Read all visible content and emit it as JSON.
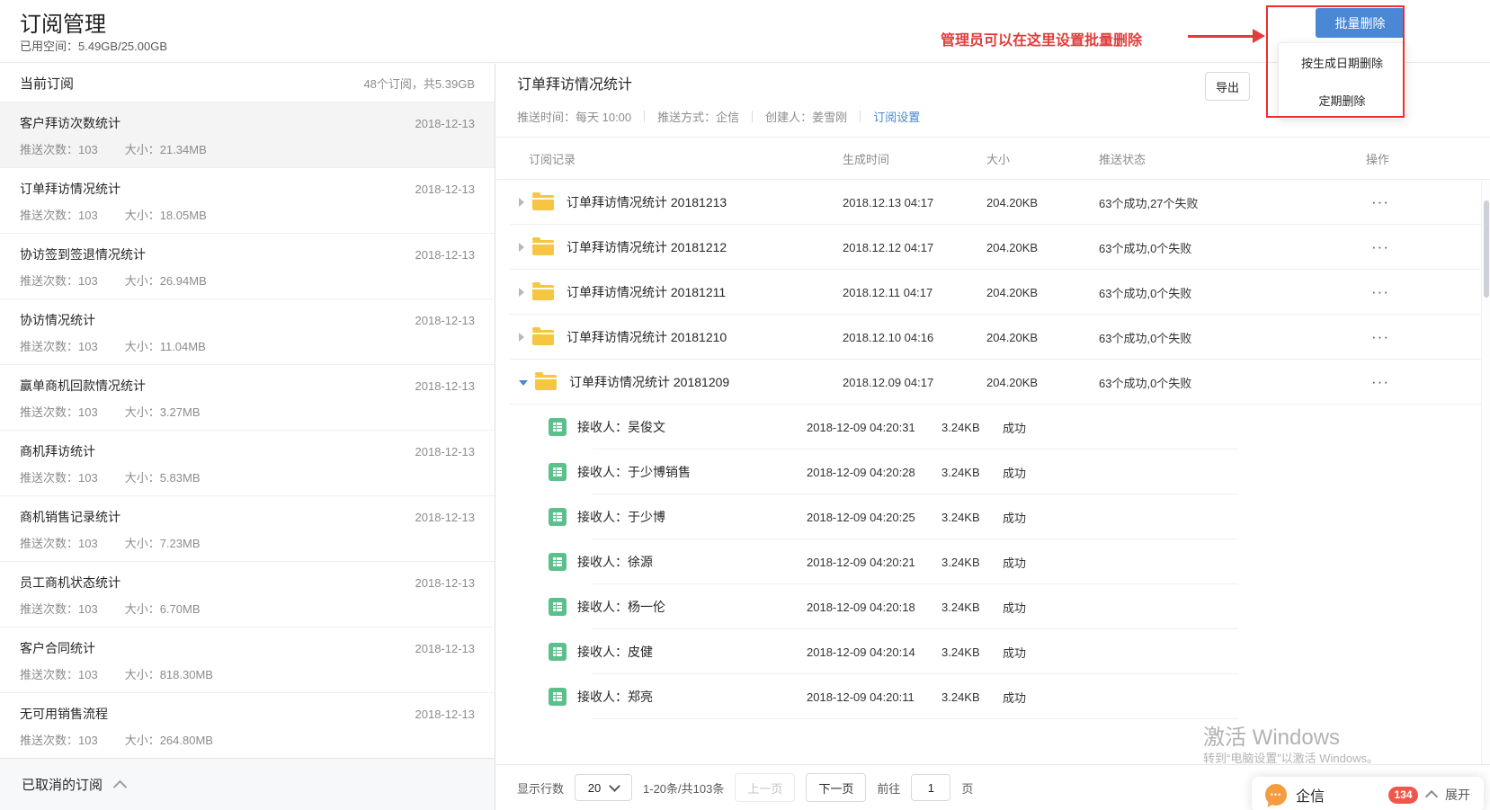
{
  "page": {
    "title": "订阅管理",
    "space_used": "已用空间：5.49GB/25.00GB"
  },
  "annotation": {
    "text": "管理员可以在这里设置批量删除",
    "color": "#e23b3b"
  },
  "batch_delete": {
    "button_label": "批量删除",
    "button_color": "#4a87d5",
    "menu_items": [
      {
        "label": "按生成日期删除"
      },
      {
        "label": "定期删除"
      }
    ]
  },
  "left_panel": {
    "header": "当前订阅",
    "summary": "48个订阅，共5.39GB",
    "items": [
      {
        "title": "客户拜访次数统计",
        "pushes": "推送次数：103",
        "size": "大小：21.34MB",
        "date": "2018-12-13",
        "selected": true
      },
      {
        "title": "订单拜访情况统计",
        "pushes": "推送次数：103",
        "size": "大小：18.05MB",
        "date": "2018-12-13",
        "selected": false
      },
      {
        "title": "协访签到签退情况统计",
        "pushes": "推送次数：103",
        "size": "大小：26.94MB",
        "date": "2018-12-13",
        "selected": false
      },
      {
        "title": "协访情况统计",
        "pushes": "推送次数：103",
        "size": "大小：11.04MB",
        "date": "2018-12-13",
        "selected": false
      },
      {
        "title": "赢单商机回款情况统计",
        "pushes": "推送次数：103",
        "size": "大小：3.27MB",
        "date": "2018-12-13",
        "selected": false
      },
      {
        "title": "商机拜访统计",
        "pushes": "推送次数：103",
        "size": "大小：5.83MB",
        "date": "2018-12-13",
        "selected": false
      },
      {
        "title": "商机销售记录统计",
        "pushes": "推送次数：103",
        "size": "大小：7.23MB",
        "date": "2018-12-13",
        "selected": false
      },
      {
        "title": "员工商机状态统计",
        "pushes": "推送次数：103",
        "size": "大小：6.70MB",
        "date": "2018-12-13",
        "selected": false
      },
      {
        "title": "客户合同统计",
        "pushes": "推送次数：103",
        "size": "大小：818.30MB",
        "date": "2018-12-13",
        "selected": false
      },
      {
        "title": "无可用销售流程",
        "pushes": "推送次数：103",
        "size": "大小：264.80MB",
        "date": "2018-12-13",
        "selected": false
      }
    ],
    "footer_label": "已取消的订阅"
  },
  "right_panel": {
    "title": "订单拜访情况统计",
    "export_label": "导出",
    "meta": [
      "推送时间：每天 10:00",
      "推送方式：企信",
      "创建人：姜雪刚"
    ],
    "settings_link": "订阅设置",
    "table": {
      "headers": [
        "订阅记录",
        "生成时间",
        "大小",
        "推送状态",
        "操作"
      ],
      "folders": [
        {
          "name": "订单拜访情况统计 20181213",
          "time": "2018.12.13 04:17",
          "size": "204.20KB",
          "status": "63个成功,27个失败",
          "expanded": false
        },
        {
          "name": "订单拜访情况统计 20181212",
          "time": "2018.12.12 04:17",
          "size": "204.20KB",
          "status": "63个成功,0个失败",
          "expanded": false
        },
        {
          "name": "订单拜访情况统计 20181211",
          "time": "2018.12.11 04:17",
          "size": "204.20KB",
          "status": "63个成功,0个失败",
          "expanded": false
        },
        {
          "name": "订单拜访情况统计 20181210",
          "time": "2018.12.10 04:16",
          "size": "204.20KB",
          "status": "63个成功,0个失败",
          "expanded": false
        },
        {
          "name": "订单拜访情况统计 20181209",
          "time": "2018.12.09 04:17",
          "size": "204.20KB",
          "status": "63个成功,0个失败",
          "expanded": true
        }
      ],
      "records": [
        {
          "receiver": "接收人：吴俊文",
          "time": "2018-12-09 04:20:31",
          "size": "3.24KB",
          "status": "成功"
        },
        {
          "receiver": "接收人：于少博销售",
          "time": "2018-12-09 04:20:28",
          "size": "3.24KB",
          "status": "成功"
        },
        {
          "receiver": "接收人：于少博",
          "time": "2018-12-09 04:20:25",
          "size": "3.24KB",
          "status": "成功"
        },
        {
          "receiver": "接收人：徐源",
          "time": "2018-12-09 04:20:21",
          "size": "3.24KB",
          "status": "成功"
        },
        {
          "receiver": "接收人：杨一伦",
          "time": "2018-12-09 04:20:18",
          "size": "3.24KB",
          "status": "成功"
        },
        {
          "receiver": "接收人：皮健",
          "time": "2018-12-09 04:20:14",
          "size": "3.24KB",
          "status": "成功"
        },
        {
          "receiver": "接收人：郑亮",
          "time": "2018-12-09 04:20:11",
          "size": "3.24KB",
          "status": "成功"
        }
      ]
    },
    "pagination": {
      "rows_label": "显示行数",
      "rows_value": "20",
      "range": "1-20条/共103条",
      "prev": "上一页",
      "next": "下一页",
      "goto_prefix": "前往",
      "page_value": "1",
      "goto_suffix": "页"
    }
  },
  "watermark": {
    "line1": "激活 Windows",
    "line2": "转到“电脑设置”以激活 Windows。"
  },
  "taskbar": {
    "app_name": "企信",
    "badge": "134",
    "expand_label": "展开"
  },
  "icons": {
    "more": "···",
    "bubble_dots": "•••"
  }
}
